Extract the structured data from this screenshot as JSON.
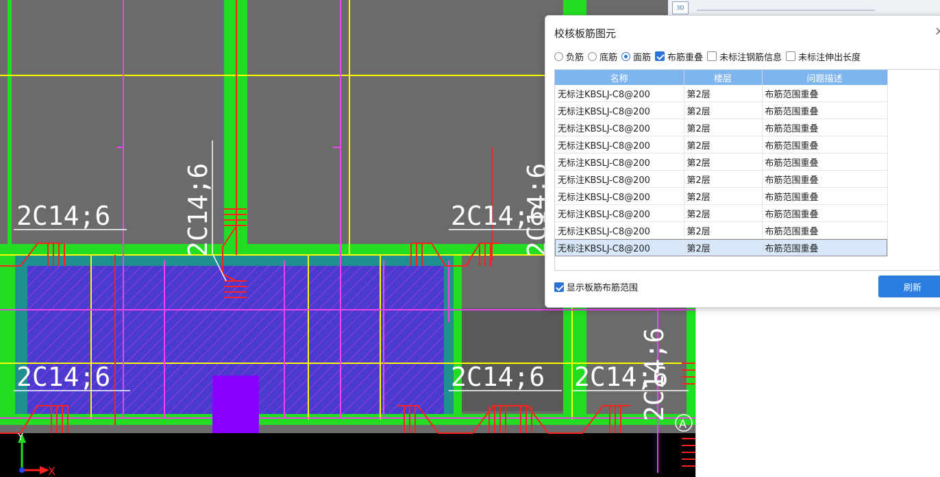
{
  "colors": {
    "background": "#6b6b6b",
    "beam_green": "#22dd22",
    "axis_yellow": "#ffff00",
    "rebar_magenta": "#ee44ee",
    "rebar_red": "#ff2020",
    "slab_blue": "#4a3acf",
    "column_purple": "#8800ff",
    "accent_blue": "#2b7de1"
  },
  "cad": {
    "rebar_labels": [
      "2C14;6",
      "2C14;6",
      "2C14;6",
      "2C14;6",
      "2C14;6",
      "2C14;6",
      "2C14;6",
      "2C14;6"
    ],
    "axis_marker": "A",
    "axis_x_label": "X",
    "axis_y_label": "Y"
  },
  "top_strip": {
    "icon_3d": "3D"
  },
  "dialog": {
    "title": "校核板筋图元",
    "close_icon": "×",
    "options": {
      "radio_negative": "负筋",
      "radio_bottom": "底筋",
      "radio_top": "面筋",
      "selected_radio": "面筋",
      "check_overlap": "布筋重叠",
      "check_overlap_checked": true,
      "check_unmarked_rebar": "未标注钢筋信息",
      "check_unmarked_rebar_checked": false,
      "check_unmarked_extension": "未标注伸出长度",
      "check_unmarked_extension_checked": false
    },
    "table": {
      "headers": [
        "名称",
        "楼层",
        "问题描述"
      ],
      "rows": [
        [
          "无标注KBSLJ-C8@200",
          "第2层",
          "布筋范围重叠"
        ],
        [
          "无标注KBSLJ-C8@200",
          "第2层",
          "布筋范围重叠"
        ],
        [
          "无标注KBSLJ-C8@200",
          "第2层",
          "布筋范围重叠"
        ],
        [
          "无标注KBSLJ-C8@200",
          "第2层",
          "布筋范围重叠"
        ],
        [
          "无标注KBSLJ-C8@200",
          "第2层",
          "布筋范围重叠"
        ],
        [
          "无标注KBSLJ-C8@200",
          "第2层",
          "布筋范围重叠"
        ],
        [
          "无标注KBSLJ-C8@200",
          "第2层",
          "布筋范围重叠"
        ],
        [
          "无标注KBSLJ-C8@200",
          "第2层",
          "布筋范围重叠"
        ],
        [
          "无标注KBSLJ-C8@200",
          "第2层",
          "布筋范围重叠"
        ],
        [
          "无标注KBSLJ-C8@200",
          "第2层",
          "布筋范围重叠"
        ]
      ],
      "selected_row": 10
    },
    "show_range_label": "显示板筋布筋范围",
    "show_range_checked": true,
    "refresh_label": "刷新"
  }
}
